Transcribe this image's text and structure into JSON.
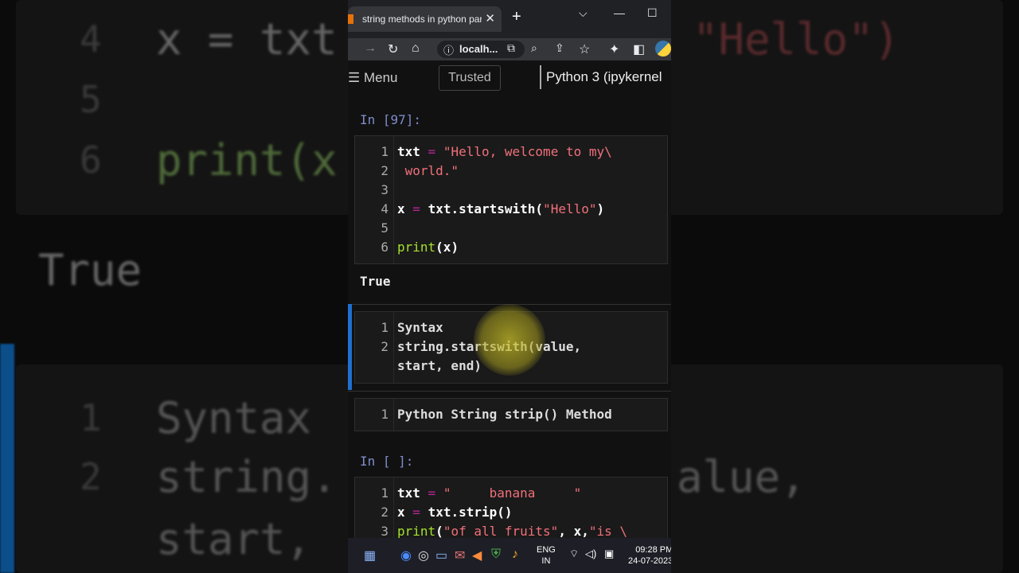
{
  "browser": {
    "tab_title": "string methods in python par",
    "tab_close": "✕",
    "new_tab": "+",
    "url": "localh...",
    "info": "ⓘ"
  },
  "jupyter": {
    "menu": "Menu",
    "trusted": "Trusted",
    "kernel": "Python 3 (ipykernel"
  },
  "cells": {
    "cell1": {
      "prompt": "In [97]:",
      "lines": [
        {
          "n": "1",
          "t": "txt = \"Hello, welcome to my\\"
        },
        {
          "n": "2",
          "t": " world.\""
        },
        {
          "n": "3",
          "t": ""
        },
        {
          "n": "4",
          "t": "x = txt.startswith(\"Hello\")"
        },
        {
          "n": "5",
          "t": ""
        },
        {
          "n": "6",
          "t": "print(x)"
        }
      ],
      "output": "True"
    },
    "cell2": {
      "lines": [
        {
          "n": "1",
          "t": "Syntax"
        },
        {
          "n": "2",
          "t": "string.startswith(value,"
        },
        {
          "n": "",
          "t": "start, end)"
        }
      ]
    },
    "cell3": {
      "lines": [
        {
          "n": "1",
          "t": "Python String strip() Method"
        }
      ]
    },
    "cell4": {
      "prompt": "In [ ]:",
      "lines": [
        {
          "n": "1",
          "t": "txt = \"     banana     \""
        },
        {
          "n": "2",
          "t": "x = txt.strip()"
        },
        {
          "n": "3",
          "t": "print(\"of all fruits\", x,\"is \\"
        }
      ]
    }
  },
  "background": {
    "lines_top": [
      "4",
      "5",
      "6"
    ],
    "code_top": [
      "x = txt",
      "",
      "print(x"
    ],
    "code_top_right": "\"Hello\")",
    "output": "True",
    "lines_bottom": [
      "1",
      "2"
    ],
    "code_bottom": [
      "Syntax",
      "string.",
      "start,"
    ],
    "code_bottom_right": [
      "alue,"
    ]
  },
  "taskbar": {
    "lang_top": "ENG",
    "lang_bottom": "IN",
    "time": "09:28 PM",
    "date": "24-07-2023"
  }
}
